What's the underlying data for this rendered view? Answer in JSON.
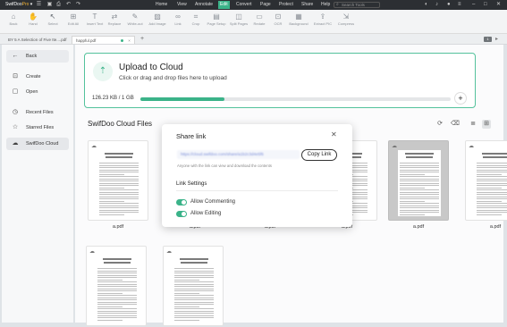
{
  "titlebar": {
    "brand": "SwifDoo",
    "brand_suffix": "Pro",
    "menus": [
      "Home",
      "View",
      "Annotate",
      "Edit",
      "Convert",
      "Page",
      "Protect",
      "Share",
      "Help"
    ],
    "active_menu": "Edit",
    "search_placeholder": "Search Tools"
  },
  "toolbar": {
    "tools": [
      "Back",
      "Hand",
      "Select",
      "Edit All",
      "Insert Text",
      "Replace",
      "White-out",
      "Add Image",
      "Link",
      "Crop",
      "Page Setup",
      "Split Pages",
      "Redate",
      "OCR",
      "Background",
      "Extract PIC",
      "Compress"
    ]
  },
  "tabs": {
    "first": "BY 5 A Selection of Five Ite....pdf",
    "current": "happful.pdf",
    "close_icon": "×",
    "add_icon": "+",
    "page": "1"
  },
  "sidebar": {
    "back": "Back",
    "items": [
      "Create",
      "Open",
      "Recent Files",
      "Starred Files",
      "SwifDoo Cloud"
    ]
  },
  "upload": {
    "title": "Upload to Cloud",
    "subtitle": "Click or drag and drop files here to upload",
    "usage": "126.23 KB / 1 GB",
    "progress": 0.27,
    "accent": "#3bb389"
  },
  "cloud": {
    "heading": "SwifDoo Cloud Files",
    "files": [
      {
        "name": "a.pdf",
        "starred": false
      },
      {
        "name": "a.pdf",
        "starred": true
      },
      {
        "name": "a.pdf",
        "starred": false
      },
      {
        "name": "a.pdf",
        "starred": false
      },
      {
        "name": "a.pdf",
        "starred": false
      },
      {
        "name": "a.pdf",
        "starred": true
      },
      {
        "name": "a.pdf",
        "starred": false
      },
      {
        "name": "a.pdf",
        "starred": false
      }
    ]
  },
  "modal": {
    "title": "Share link",
    "link": "https://cloud.swifdoo.com/share/a1b2c3d4e5f6",
    "copy_button": "Copy Link",
    "note": "Anyone with the link can view and download the contents",
    "settings_title": "Link Settings",
    "allow_commenting": "Allow Commenting",
    "allow_editing": "Allow Editing",
    "commenting_on": true,
    "editing_on": true
  }
}
